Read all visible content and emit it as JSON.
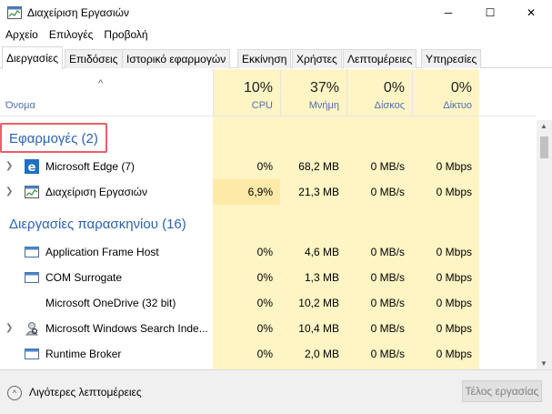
{
  "window": {
    "title": "Διαχείριση Εργασιών",
    "minimize_glyph": "─",
    "maximize_glyph": "☐",
    "close_glyph": "✕"
  },
  "menu": [
    "Αρχείο",
    "Επιλογές",
    "Προβολή"
  ],
  "tabs": [
    {
      "label": "Διεργασίες",
      "active": true
    },
    {
      "label": "Επιδόσεις"
    },
    {
      "label": "Ιστορικό εφαρμογών"
    },
    {
      "label": "Εκκίνηση"
    },
    {
      "label": "Χρήστες"
    },
    {
      "label": "Λεπτομέρειες"
    },
    {
      "label": "Υπηρεσίες"
    }
  ],
  "columns": {
    "name": {
      "label": "Όνομα",
      "sort_glyph": "^"
    },
    "cpu": {
      "percent": "10%",
      "label": "CPU"
    },
    "memory": {
      "percent": "37%",
      "label": "Μνήμη"
    },
    "disk": {
      "percent": "0%",
      "label": "Δίσκος"
    },
    "network": {
      "percent": "0%",
      "label": "Δίκτυο"
    }
  },
  "groups": {
    "apps": {
      "title": "Εφαρμογές (2)"
    },
    "background": {
      "title": "Διεργασίες παρασκηνίου (16)"
    }
  },
  "apps": [
    {
      "name": "Microsoft Edge (7)",
      "cpu": "0%",
      "memory": "68,2 MB",
      "disk": "0 MB/s",
      "network": "0 Mbps",
      "icon": "edge-icon",
      "expandable": true
    },
    {
      "name": "Διαχείριση Εργασιών",
      "cpu": "6,9%",
      "memory": "21,3 MB",
      "disk": "0 MB/s",
      "network": "0 Mbps",
      "icon": "task-manager-icon",
      "expandable": true
    }
  ],
  "background": [
    {
      "name": "Application Frame Host",
      "cpu": "0%",
      "memory": "4,6 MB",
      "disk": "0 MB/s",
      "network": "0 Mbps",
      "icon": "window-icon",
      "expandable": false
    },
    {
      "name": "COM Surrogate",
      "cpu": "0%",
      "memory": "1,3 MB",
      "disk": "0 MB/s",
      "network": "0 Mbps",
      "icon": "window-icon",
      "expandable": false
    },
    {
      "name": "Microsoft OneDrive (32 bit)",
      "cpu": "0%",
      "memory": "10,2 MB",
      "disk": "0 MB/s",
      "network": "0 Mbps",
      "icon": "",
      "expandable": false
    },
    {
      "name": "Microsoft Windows Search Inde...",
      "cpu": "0%",
      "memory": "10,4 MB",
      "disk": "0 MB/s",
      "network": "0 Mbps",
      "icon": "search-indexer-icon",
      "expandable": true
    },
    {
      "name": "Runtime Broker",
      "cpu": "0%",
      "memory": "2,0 MB",
      "disk": "0 MB/s",
      "network": "0 Mbps",
      "icon": "window-icon",
      "expandable": false
    }
  ],
  "footer": {
    "fewer_details": "Λιγότερες λεπτομέρειες",
    "fewer_glyph": "^",
    "end_task": "Τέλος εργασίας"
  },
  "colors": {
    "highlight_column": "#fff4c4",
    "group_title": "#2a62b7",
    "column_label": "#4c6fb3",
    "annotation_box": "#e8606a"
  }
}
